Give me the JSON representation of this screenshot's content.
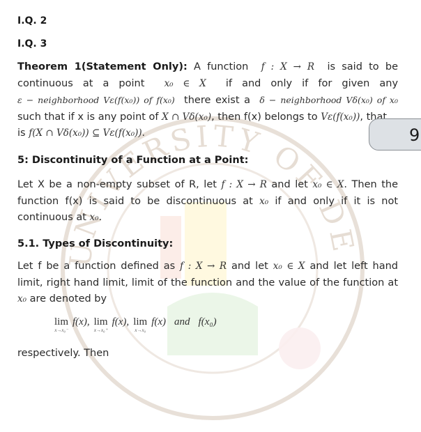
{
  "headings": {
    "iq2": "I.Q. 2",
    "iq3": "I.Q. 3",
    "section5": "5: Discontinuity of a Function at a Point:",
    "section51": "5.1. Types of Discontinuity:"
  },
  "theorem": {
    "label": "Theorem 1(Statement Only):",
    "line1_a": "A function",
    "line1_math": "f : X → R",
    "line1_b": "is said to be",
    "line2_a": "continuous at a point",
    "line2_math": "x₀ ∈ X",
    "line2_b": "if and only if for given any",
    "line3_math1": "ε − neighborhood Vε(f(x₀)) of f(x₀)",
    "line3_text": "there exist a",
    "line3_math2": "δ − neighborhood Vδ(x₀) of x₀",
    "line4_a": "such that if x is any point of",
    "line4_math1": "X ∩ Vδ(x₀)",
    "line4_b": ", then f(x) belongs to",
    "line4_math2": "Vε(f(x₀))",
    "line4_c": ", that",
    "line5_a": "is",
    "line5_math": "f(X ∩ Vδ(x₀)) ⊆ Vε(f(x₀))."
  },
  "section5_body": {
    "line1_a": "Let X be a non-empty subset of R, let",
    "line1_math1": "f : X → R",
    "line1_b": "and let",
    "line1_math2": "x₀ ∈ X",
    "line1_c": ". Then the",
    "line2_a": "function f(x) is said to be discontinuous at",
    "line2_math": "x₀",
    "line2_b": "if and only if it is not",
    "line3_a": "continuous at",
    "line3_math": "x₀",
    "line3_b": "."
  },
  "section51_body": {
    "line1_a": "Let f be a function defined as",
    "line1_math1": "f : X → R",
    "line1_b": "and let",
    "line1_math2": "x₀ ∈ X",
    "line1_c": "and let left hand",
    "line2": "limit, right hand limit, limit of the function and the value of the function at",
    "line3_math": "x₀",
    "line3_b": "are denoted by",
    "equation": {
      "lim_word": "lim",
      "sub_left": "x→x₀⁻",
      "sub_right": "x→x₀⁺",
      "sub_both": "x→x₀",
      "fx1": "f(x),",
      "fx2": "f(x),",
      "fx3": "f(x)",
      "and": "and",
      "fx0": "f(x₀)"
    },
    "line_after": "respectively. Then"
  },
  "page_badge": {
    "number": "9"
  },
  "watermark": {
    "text": "UNIVERSITY OF DELHI"
  }
}
